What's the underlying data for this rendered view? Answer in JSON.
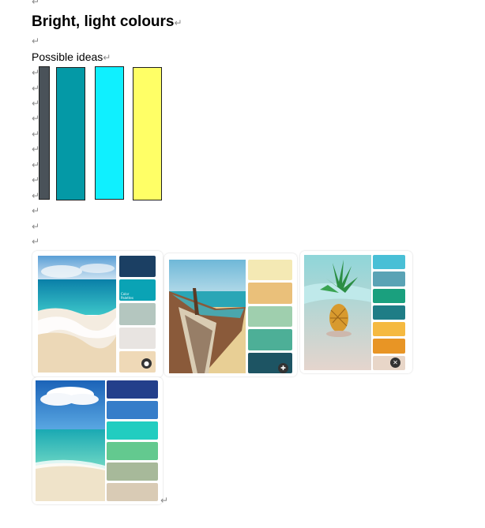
{
  "document": {
    "heading": "Bright, light colours",
    "subheading": "Possible ideas",
    "paragraph_mark": "↵"
  },
  "color_bars": [
    {
      "name": "dark-slate",
      "color": "#4a5259"
    },
    {
      "name": "teal",
      "color": "#0499a6"
    },
    {
      "name": "cyan",
      "color": "#0ff0ff"
    },
    {
      "name": "yellow",
      "color": "#ffff66"
    }
  ],
  "palette_images": [
    {
      "name": "beach-waves-palette",
      "swatches": [
        "#1b3f63",
        "#0aa3b5",
        "#b4c6bf",
        "#e8e4e1",
        "#efd9b7"
      ],
      "card_label": "Color Palettes",
      "badge_icon": "lock-icon"
    },
    {
      "name": "old-boat-palette",
      "swatches": [
        "#f4e9b4",
        "#eac07a",
        "#9fcfae",
        "#4daf97",
        "#1d5463"
      ],
      "card_label": "",
      "badge_icon": "arrows-icon"
    },
    {
      "name": "pineapple-palette",
      "swatches": [
        "#49bfd6",
        "#5aa3b5",
        "#1aa07e",
        "#1f7d86",
        "#f5b940",
        "#e89525",
        "#e8d6c8"
      ],
      "card_label": "",
      "badge_icon": "close-icon"
    },
    {
      "name": "tropical-sea-palette",
      "swatches": [
        "#233f8b",
        "#367dc9",
        "#22cdc0",
        "#63c98f",
        "#a7b99a",
        "#d9cbb5"
      ],
      "card_label": "",
      "badge_icon": ""
    }
  ]
}
